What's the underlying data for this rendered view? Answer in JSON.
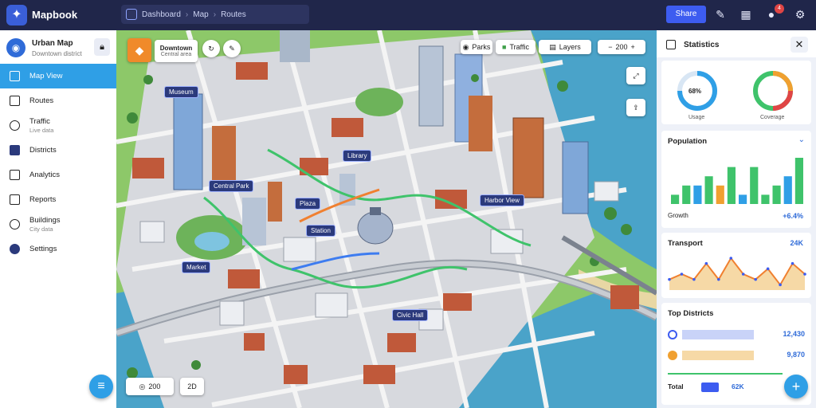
{
  "app": {
    "title": "Mapbook",
    "logo_icon": "compass-icon"
  },
  "breadcrumbs": [
    "Dashboard",
    "Map",
    "Routes"
  ],
  "topbar": {
    "primary_button": "Share",
    "notification_count": "4"
  },
  "profile": {
    "name": "Urban Map",
    "subtitle": "Downtown district"
  },
  "nav": [
    {
      "label": "Map View",
      "active": true,
      "icon": "map-icon"
    },
    {
      "label": "Routes",
      "sub": "",
      "icon": "route-icon"
    },
    {
      "label": "Traffic",
      "sub": "Live data",
      "icon": "clock-icon"
    },
    {
      "label": "Districts",
      "icon": "grid-icon"
    },
    {
      "label": "Analytics",
      "icon": "chart-icon"
    },
    {
      "label": "Reports",
      "icon": "send-icon"
    },
    {
      "label": "Buildings",
      "sub": "City data",
      "icon": "circle-icon"
    },
    {
      "label": "Settings",
      "icon": "gear-icon"
    }
  ],
  "map": {
    "search_value": "Downtown",
    "search_sub": "Central area",
    "filters": [
      "Parks",
      "Traffic",
      "Layers"
    ],
    "labels": [
      "Museum",
      "Central Park",
      "Plaza",
      "Harbor View",
      "Station",
      "Market",
      "Civic Hall",
      "Library"
    ],
    "zoom_level": "200",
    "scale": "2D"
  },
  "panel": {
    "title": "Statistics",
    "gauge_a": {
      "value": "68%",
      "label": "Usage"
    },
    "gauge_b": {
      "label": "Coverage"
    },
    "card1": {
      "title": "Population",
      "footer_label": "Growth",
      "footer_value": "+6.4%"
    },
    "card2": {
      "title": "Transport",
      "value": "24K"
    },
    "card3": {
      "title": "Top Districts"
    },
    "rows": [
      {
        "value": "12,430",
        "color": "#3d5cf0"
      },
      {
        "value": "9,870",
        "color": "#f0a030"
      },
      {
        "value": ""
      }
    ],
    "footer": {
      "label": "Total",
      "value": "62K"
    }
  },
  "chart_data": [
    {
      "type": "bar",
      "title": "Population",
      "values": [
        1,
        2,
        2,
        3,
        2,
        4,
        1,
        4,
        1,
        2,
        3,
        5
      ]
    },
    {
      "type": "line",
      "title": "Transport",
      "values": [
        2,
        3,
        2,
        5,
        2,
        6,
        3,
        2,
        4,
        1,
        5,
        3
      ]
    }
  ]
}
